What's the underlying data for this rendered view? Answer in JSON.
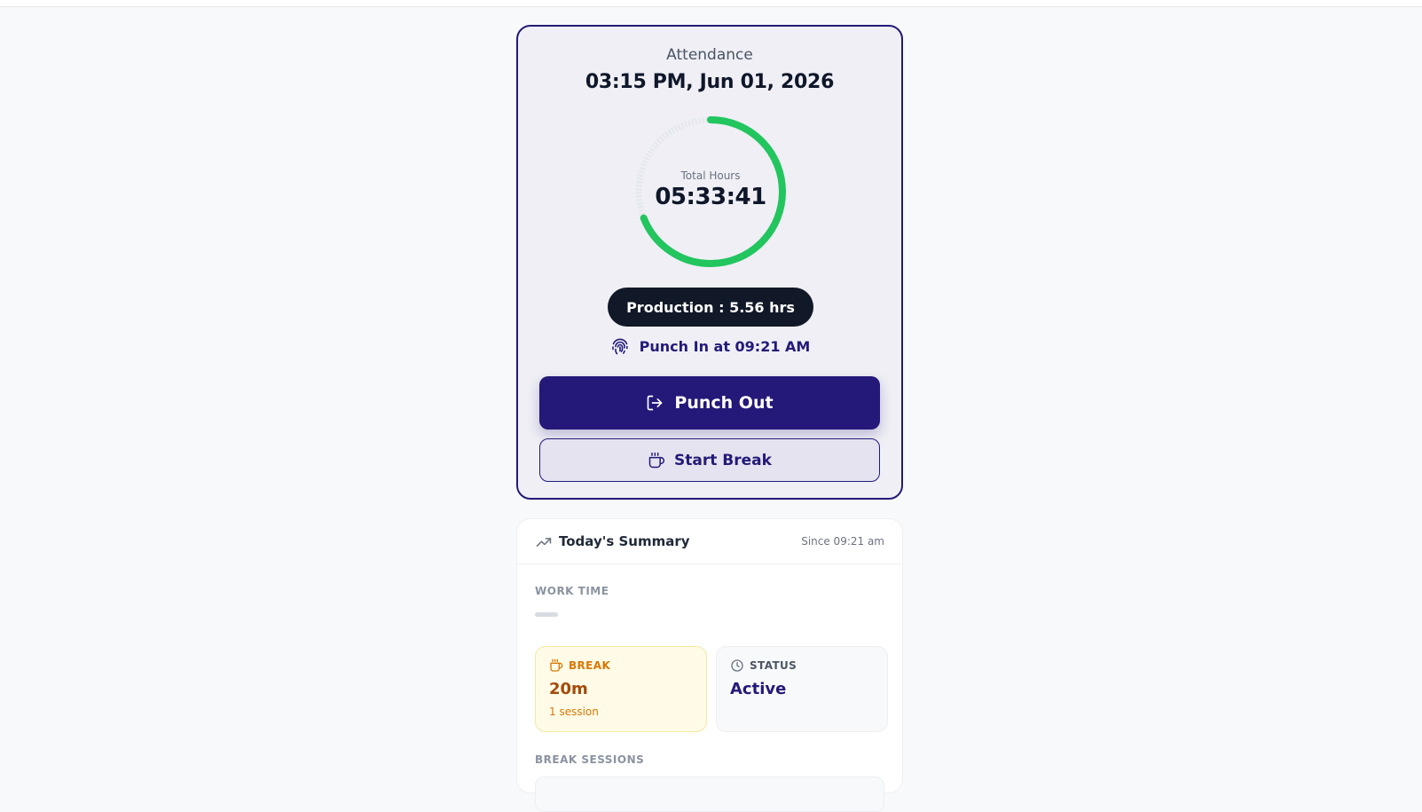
{
  "attendance": {
    "label": "Attendance",
    "datetime": "03:15 PM, Jun 01, 2026",
    "ring": {
      "caption": "Total Hours",
      "value": "05:33:41",
      "progress": 0.69,
      "color": "#22c55e",
      "track_color": "#e5e7eb"
    },
    "production": "Production : 5.56 hrs",
    "punch_in": {
      "icon": "fingerprint-icon",
      "text": "Punch In at 09:21 AM"
    },
    "punch_out_button": {
      "icon": "logout-icon",
      "label": "Punch Out"
    },
    "break_button": {
      "icon": "coffee-cup-icon",
      "label": "Start Break"
    }
  },
  "summary": {
    "icon": "trending-up-icon",
    "title": "Today's Summary",
    "since": "Since 09:21 am",
    "work_time_label": "WORK TIME",
    "break_tile": {
      "icon": "coffee-cup-icon",
      "label": "BREAK",
      "value": "20m",
      "sub": "1 session"
    },
    "status_tile": {
      "icon": "clock-icon",
      "label": "STATUS",
      "value": "Active"
    },
    "break_sessions_label": "BREAK SESSIONS"
  },
  "colors": {
    "primary": "#241878",
    "success": "#22c55e",
    "warning": "#d97706",
    "dark": "#111827"
  }
}
